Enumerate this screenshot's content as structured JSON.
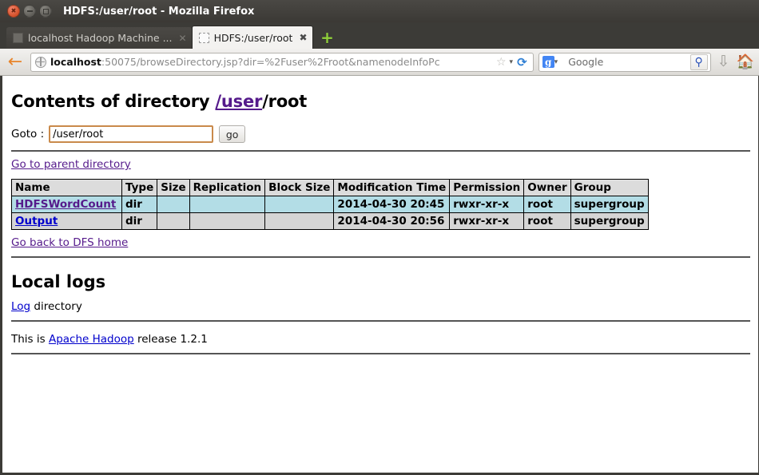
{
  "window": {
    "title": "HDFS:/user/root - Mozilla Firefox",
    "close_label": "×",
    "minimize_label": "–",
    "maximize_label": "□"
  },
  "tabs": [
    {
      "label": "localhost Hadoop Machine ...",
      "close_label": "✕",
      "active": false
    },
    {
      "label": "HDFS:/user/root",
      "close_label": "✖",
      "active": true
    }
  ],
  "newtab_label": "+",
  "toolbar": {
    "back_label": "←",
    "url_host": "localhost",
    "url_rest": ":50075/browseDirectory.jsp?dir=%2Fuser%2Froot&namenodeInfoPc",
    "star_label": "☆",
    "caret_label": "▾",
    "reload_label": "⟳",
    "search_engine_letter": "g",
    "search_engine_caret": "▾",
    "search_placeholder": "Google",
    "search_go_label": "⚲",
    "download_label": "⇩",
    "home_label": "🏠"
  },
  "page": {
    "heading_prefix": "Contents of directory ",
    "heading_link": "/user",
    "heading_suffix": "/root",
    "goto_label": "Goto :",
    "goto_value": "/user/root",
    "goto_placeholder": "/user/root",
    "go_button": "go",
    "parent_link": "Go to parent directory",
    "dfs_home_link": "Go back to DFS home",
    "local_logs_heading": "Local logs",
    "log_link": "Log",
    "log_suffix": " directory",
    "release_prefix": "This is ",
    "release_link": "Apache Hadoop",
    "release_suffix": " release 1.2.1"
  },
  "table": {
    "columns": [
      "Name",
      "Type",
      "Size",
      "Replication",
      "Block Size",
      "Modification Time",
      "Permission",
      "Owner",
      "Group"
    ],
    "rows": [
      {
        "name": "HDFSWordCount",
        "type": "dir",
        "size": "",
        "replication": "",
        "block_size": "",
        "modification_time": "2014-04-30 20:45",
        "permission": "rwxr-xr-x",
        "owner": "root",
        "group": "supergroup",
        "link_state": "visited",
        "row_style": "row-a"
      },
      {
        "name": "Output",
        "type": "dir",
        "size": "",
        "replication": "",
        "block_size": "",
        "modification_time": "2014-04-30 20:56",
        "permission": "rwxr-xr-x",
        "owner": "root",
        "group": "supergroup",
        "link_state": "unvisited",
        "row_style": "row-b"
      }
    ]
  },
  "colors": {
    "chrome": "#3c3b37",
    "link_unvisited": "#0000cc",
    "link_visited": "#551a8b",
    "row_highlight": "#b3dde6",
    "row_normal": "#d5d5d5",
    "header_bg": "#dcdcdc",
    "focus_border": "#c98a4b"
  }
}
